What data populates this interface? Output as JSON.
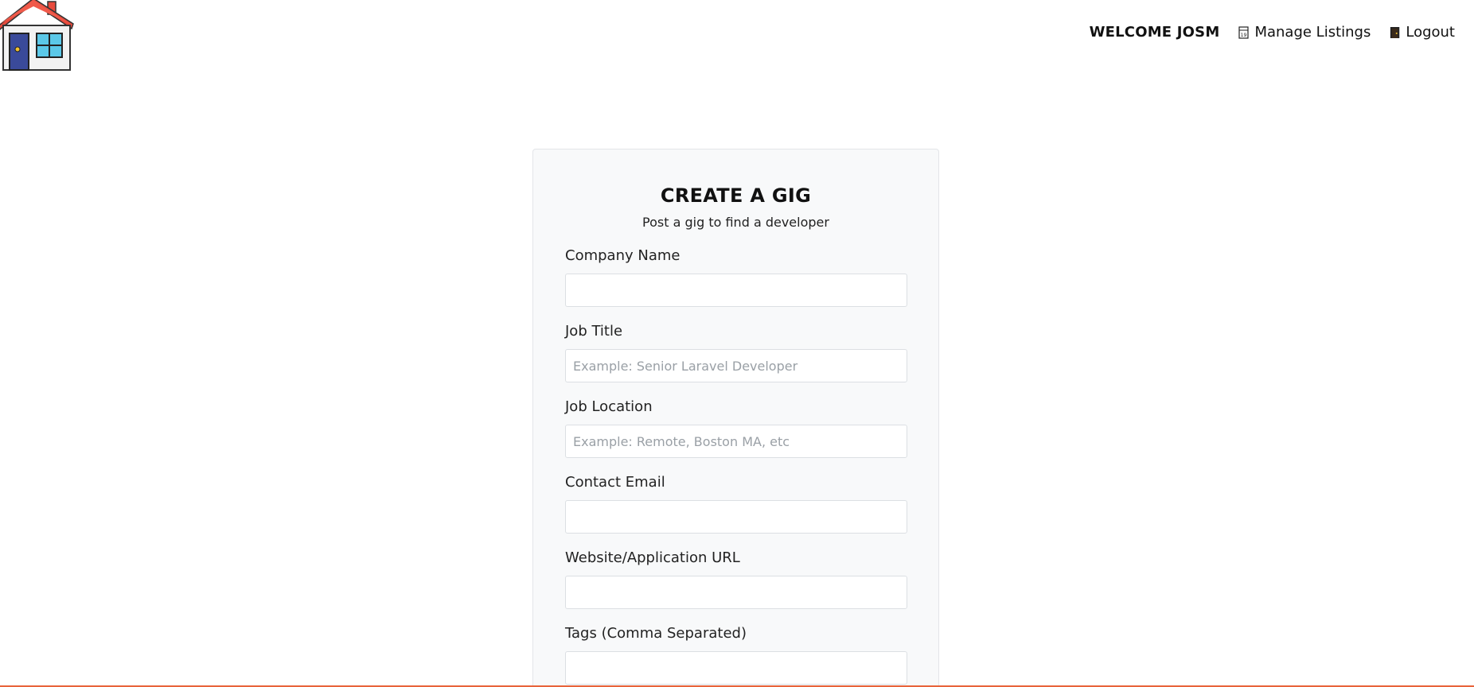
{
  "nav": {
    "welcome": "WELCOME JOSM",
    "manage_listings": "Manage Listings",
    "logout": "Logout"
  },
  "form": {
    "title": "CREATE A GIG",
    "subtitle": "Post a gig to find a developer",
    "fields": [
      {
        "label": "Company Name",
        "placeholder": "",
        "value": ""
      },
      {
        "label": "Job Title",
        "placeholder": "Example: Senior Laravel Developer",
        "value": ""
      },
      {
        "label": "Job Location",
        "placeholder": "Example: Remote, Boston MA, etc",
        "value": ""
      },
      {
        "label": "Contact Email",
        "placeholder": "",
        "value": ""
      },
      {
        "label": "Website/Application URL",
        "placeholder": "",
        "value": ""
      },
      {
        "label": "Tags (Comma Separated)",
        "placeholder": "",
        "value": ""
      }
    ]
  },
  "colors": {
    "card_bg": "#f8f9fa",
    "accent_line": "#e8633a",
    "roof": "#e84a3c",
    "window": "#5bc8e8",
    "door": "#3a4a9a"
  },
  "icons": {
    "logo": "house-icon",
    "manage": "calendar-icon",
    "logout": "door-icon"
  }
}
